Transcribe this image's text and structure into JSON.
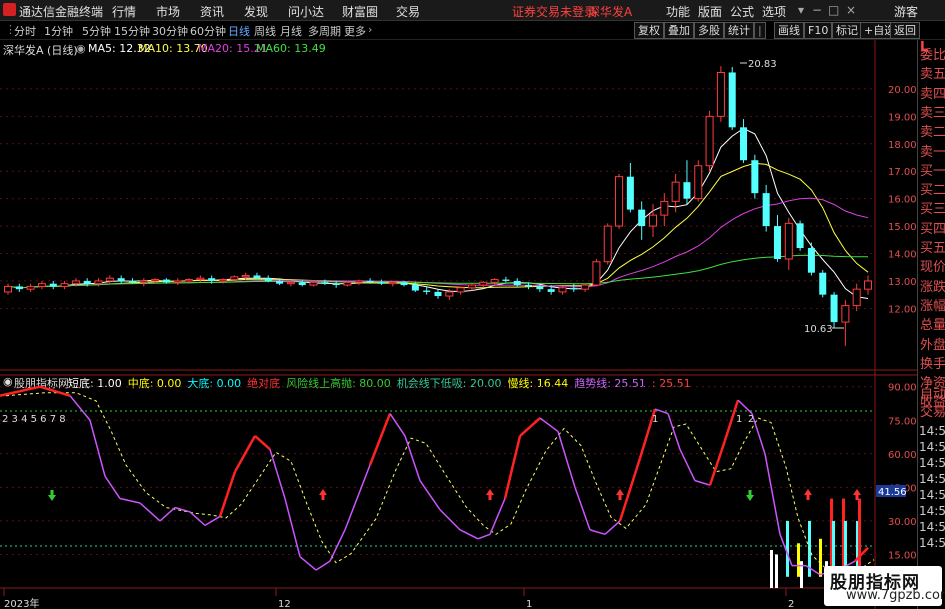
{
  "titlebar": {
    "app_title": "通达信金融终端",
    "menus": [
      "行情",
      "市场",
      "资讯",
      "发现",
      "问小达",
      "财富圈",
      "交易"
    ],
    "status": "证券交易未登录",
    "stock_title": "深华发A",
    "right_menus": [
      "功能",
      "版面",
      "公式",
      "选项"
    ],
    "user": "游客"
  },
  "periodbar": {
    "periods": [
      "分时",
      "1分钟",
      "5分钟",
      "15分钟",
      "30分钟",
      "60分钟",
      "日线",
      "周线",
      "月线",
      "多周期",
      "更多"
    ],
    "active": "日线",
    "tools": [
      "复权",
      "叠加",
      "多股",
      "统计",
      "画线",
      "F10",
      "标记",
      "+自选",
      "返回"
    ]
  },
  "main_legend": {
    "stock": "深华发A (日线)",
    "ma5": "MA5: 12.32",
    "ma10": "MA10: 13.70",
    "ma20": "MA20: 15.21",
    "ma60": "MA60: 13.49"
  },
  "price_axis": [
    "20.00",
    "19.00",
    "18.00",
    "17.00",
    "16.00",
    "15.00",
    "14.00",
    "13.00",
    "12.00"
  ],
  "price_annotations": {
    "high": "20.83",
    "low": "10.63"
  },
  "indicator_legend": {
    "name": "股朋指标网",
    "items": [
      {
        "label": "短底: 1.00",
        "color": "#ffffff"
      },
      {
        "label": "中底: 0.00",
        "color": "#ffff00"
      },
      {
        "label": "大底: 0.00",
        "color": "#00ffff"
      },
      {
        "label": "绝对底",
        "color": "#ff3333"
      },
      {
        "label": "风险线上高抛: 80.00",
        "color": "#33cc33"
      },
      {
        "label": "机会线下低吸: 20.00",
        "color": "#33cc99"
      },
      {
        "label": "慢线: 16.44",
        "color": "#ffff00"
      },
      {
        "label": "趋势线: 25.51",
        "color": "#cc66ff"
      },
      {
        "label": ": 25.51",
        "color": "#ff4444"
      }
    ]
  },
  "indicator_axis": [
    "90.00",
    "75.00",
    "60.00",
    "45.00",
    "30.00",
    "15.00"
  ],
  "indicator_current": "41.56",
  "indicator_numbers": "2 3 4 5 6 7 8",
  "indicator_marks": [
    "1",
    "1",
    "2"
  ],
  "date_axis": [
    "2023年",
    "12",
    "1",
    "2"
  ],
  "rightpanel": {
    "labels": [
      "委比",
      "卖五",
      "卖四",
      "卖三",
      "卖二",
      "卖一",
      "买一",
      "买二",
      "买三",
      "买四",
      "买五",
      "现价",
      "涨跌",
      "涨幅",
      "总量",
      "外盘",
      "换手",
      "净资",
      "收益",
      "自动",
      "交易"
    ],
    "times": [
      "14:55",
      "14:55",
      "14:55",
      "14:56",
      "14:56",
      "14:56",
      "14:56",
      "14:56"
    ]
  },
  "chart_data": {
    "type": "candlestick",
    "ylim": [
      10.3,
      21.2
    ],
    "candles": [
      [
        12.6,
        12.9,
        12.5,
        12.8
      ],
      [
        12.8,
        12.9,
        12.6,
        12.7
      ],
      [
        12.7,
        12.9,
        12.6,
        12.8
      ],
      [
        12.8,
        13.0,
        12.7,
        12.9
      ],
      [
        12.9,
        13.0,
        12.7,
        12.8
      ],
      [
        12.8,
        13.0,
        12.7,
        12.9
      ],
      [
        12.9,
        13.1,
        12.8,
        13.0
      ],
      [
        13.0,
        13.1,
        12.8,
        12.9
      ],
      [
        12.9,
        13.1,
        12.8,
        13.0
      ],
      [
        13.0,
        13.2,
        12.9,
        13.1
      ],
      [
        13.1,
        13.2,
        12.9,
        13.0
      ],
      [
        13.0,
        13.1,
        12.9,
        12.95
      ],
      [
        12.95,
        13.1,
        12.8,
        13.0
      ],
      [
        13.0,
        13.1,
        12.9,
        13.05
      ],
      [
        13.05,
        13.1,
        12.9,
        12.95
      ],
      [
        12.95,
        13.1,
        12.85,
        13.0
      ],
      [
        13.0,
        13.1,
        12.9,
        13.05
      ],
      [
        13.05,
        13.2,
        12.95,
        13.1
      ],
      [
        13.1,
        13.2,
        12.9,
        13.0
      ],
      [
        13.0,
        13.1,
        12.9,
        13.05
      ],
      [
        13.05,
        13.2,
        13.0,
        13.15
      ],
      [
        13.15,
        13.3,
        13.05,
        13.2
      ],
      [
        13.2,
        13.3,
        13.05,
        13.1
      ],
      [
        13.1,
        13.2,
        12.95,
        13.0
      ],
      [
        13.0,
        13.1,
        12.85,
        12.9
      ],
      [
        12.9,
        13.0,
        12.8,
        12.95
      ],
      [
        12.95,
        13.05,
        12.8,
        12.85
      ],
      [
        12.85,
        13.0,
        12.8,
        12.95
      ],
      [
        12.95,
        13.05,
        12.85,
        12.9
      ],
      [
        12.9,
        13.0,
        12.75,
        12.85
      ],
      [
        12.85,
        13.0,
        12.8,
        12.95
      ],
      [
        12.95,
        13.05,
        12.85,
        13.0
      ],
      [
        13.0,
        13.1,
        12.9,
        12.95
      ],
      [
        12.95,
        13.05,
        12.85,
        12.9
      ],
      [
        12.9,
        13.0,
        12.8,
        12.95
      ],
      [
        12.95,
        13.0,
        12.8,
        12.85
      ],
      [
        12.85,
        12.95,
        12.6,
        12.65
      ],
      [
        12.65,
        12.8,
        12.5,
        12.6
      ],
      [
        12.6,
        12.7,
        12.35,
        12.45
      ],
      [
        12.45,
        12.7,
        12.3,
        12.6
      ],
      [
        12.6,
        12.8,
        12.5,
        12.75
      ],
      [
        12.75,
        12.9,
        12.65,
        12.85
      ],
      [
        12.85,
        13.0,
        12.75,
        12.95
      ],
      [
        12.95,
        13.1,
        12.85,
        13.05
      ],
      [
        13.05,
        13.15,
        12.95,
        13.0
      ],
      [
        13.0,
        13.1,
        12.8,
        12.85
      ],
      [
        12.85,
        12.95,
        12.7,
        12.8
      ],
      [
        12.8,
        12.9,
        12.6,
        12.7
      ],
      [
        12.7,
        12.85,
        12.5,
        12.6
      ],
      [
        12.6,
        12.8,
        12.5,
        12.75
      ],
      [
        12.75,
        12.9,
        12.6,
        12.7
      ],
      [
        12.7,
        12.9,
        12.6,
        12.85
      ],
      [
        12.85,
        13.8,
        12.8,
        13.7
      ],
      [
        13.7,
        15.1,
        13.6,
        15.0
      ],
      [
        15.0,
        16.9,
        14.9,
        16.8
      ],
      [
        16.8,
        17.3,
        15.5,
        15.6
      ],
      [
        15.6,
        15.9,
        14.5,
        15.0
      ],
      [
        15.0,
        15.8,
        14.6,
        15.4
      ],
      [
        15.4,
        16.2,
        15.0,
        15.9
      ],
      [
        15.9,
        16.9,
        15.5,
        16.6
      ],
      [
        16.6,
        17.4,
        15.8,
        16.0
      ],
      [
        16.0,
        17.4,
        15.9,
        17.2
      ],
      [
        17.2,
        19.2,
        17.0,
        19.0
      ],
      [
        19.0,
        20.83,
        18.8,
        20.6
      ],
      [
        20.6,
        20.8,
        18.5,
        18.6
      ],
      [
        18.6,
        18.9,
        17.3,
        17.4
      ],
      [
        17.4,
        17.6,
        16.0,
        16.2
      ],
      [
        16.2,
        16.5,
        14.8,
        15.0
      ],
      [
        15.0,
        15.4,
        13.7,
        13.8
      ],
      [
        13.8,
        15.3,
        13.4,
        15.1
      ],
      [
        15.1,
        15.2,
        14.1,
        14.2
      ],
      [
        14.2,
        14.4,
        13.2,
        13.3
      ],
      [
        13.3,
        13.4,
        12.4,
        12.5
      ],
      [
        12.5,
        12.6,
        11.3,
        11.5
      ],
      [
        11.5,
        12.3,
        10.63,
        12.1
      ],
      [
        12.1,
        12.9,
        11.9,
        12.7
      ],
      [
        12.7,
        13.2,
        12.5,
        13.0
      ]
    ]
  }
}
